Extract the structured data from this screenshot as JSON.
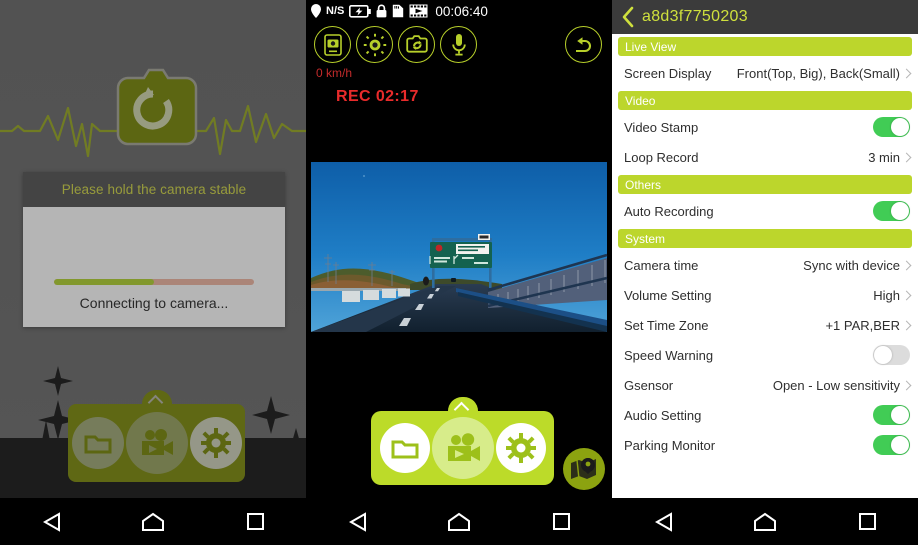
{
  "colors": {
    "brand_green": "#bcd62c",
    "brand_green_dim": "#7f8c10",
    "toggle_on": "#41cc55",
    "toggle_off": "#dcdcdc",
    "title_text": "#cfe03d",
    "rec_red": "#e82b2b",
    "progress_fill": "#b4d435",
    "progress_track": "#f0b8a4"
  },
  "panel1": {
    "name": "camera-connecting-screen",
    "logo_icon": "camera-refresh-icon",
    "background_icon": "heartbeat-line-icon",
    "dialog": {
      "title": "Please hold the camera stable",
      "status": "Connecting to camera...",
      "progress_percent": 50
    },
    "toolbar": [
      {
        "icon": "folder-icon",
        "label": "Files"
      },
      {
        "icon": "video-camera-icon",
        "label": "Live Video"
      },
      {
        "icon": "gear-icon",
        "label": "Settings"
      }
    ],
    "expand_caret_icon": "chevron-up-icon"
  },
  "panel2": {
    "name": "live-view-screen",
    "statusbar": {
      "gps_icon": "location-pin-icon",
      "gps_label": "N/S",
      "battery_icon": "battery-charging-icon",
      "lock_icon": "lock-icon",
      "sdcard_icon": "sd-card-icon",
      "video_icon": "film-strip-icon",
      "clock": "00:06:40"
    },
    "toolbar": [
      {
        "icon": "snapshot-to-phone-icon",
        "label": "Snapshot"
      },
      {
        "icon": "brightness-icon",
        "label": "Brightness"
      },
      {
        "icon": "camera-switch-icon",
        "label": "Switch Camera"
      },
      {
        "icon": "microphone-icon",
        "label": "Microphone"
      }
    ],
    "return_button": {
      "icon": "return-arrow-icon",
      "label": "Back"
    },
    "overlay": {
      "speed": "0 km/h",
      "recording": "REC 02:17"
    },
    "bottom_toolbar": [
      {
        "icon": "folder-icon",
        "label": "Files"
      },
      {
        "icon": "video-camera-icon",
        "label": "Live Video"
      },
      {
        "icon": "gear-icon",
        "label": "Settings"
      }
    ],
    "gps_button": {
      "icon": "map-pin-icon",
      "label": "GPS Map"
    },
    "expand_caret_icon": "chevron-up-icon"
  },
  "panel3": {
    "name": "camera-settings-screen",
    "header": {
      "back_icon": "chevron-left-icon",
      "title": "a8d3f7750203"
    },
    "sections": [
      {
        "title": "Live View",
        "rows": [
          {
            "label": "Screen Display",
            "type": "value",
            "value": "Front(Top, Big), Back(Small)"
          }
        ]
      },
      {
        "title": "Video",
        "rows": [
          {
            "label": "Video Stamp",
            "type": "toggle",
            "value": "on"
          },
          {
            "label": "Loop Record",
            "type": "value",
            "value": "3 min"
          }
        ]
      },
      {
        "title": "Others",
        "rows": [
          {
            "label": "Auto Recording",
            "type": "toggle",
            "value": "on"
          }
        ]
      },
      {
        "title": "System",
        "rows": [
          {
            "label": "Camera time",
            "type": "value",
            "value": "Sync with device"
          },
          {
            "label": "Volume Setting",
            "type": "value",
            "value": "High"
          },
          {
            "label": "Set Time Zone",
            "type": "value",
            "value": "+1 PAR,BER"
          },
          {
            "label": "Speed Warning",
            "type": "toggle",
            "value": "off"
          },
          {
            "label": "Gsensor",
            "type": "value",
            "value": "Open - Low sensitivity"
          },
          {
            "label": "Audio Setting",
            "type": "toggle",
            "value": "on"
          },
          {
            "label": "Parking Monitor",
            "type": "toggle",
            "value": "on"
          }
        ]
      }
    ]
  },
  "navbar": {
    "back": {
      "icon": "triangle-back-icon",
      "label": "Back"
    },
    "home": {
      "icon": "house-home-icon",
      "label": "Home"
    },
    "recents": {
      "icon": "square-recents-icon",
      "label": "Recents"
    }
  }
}
